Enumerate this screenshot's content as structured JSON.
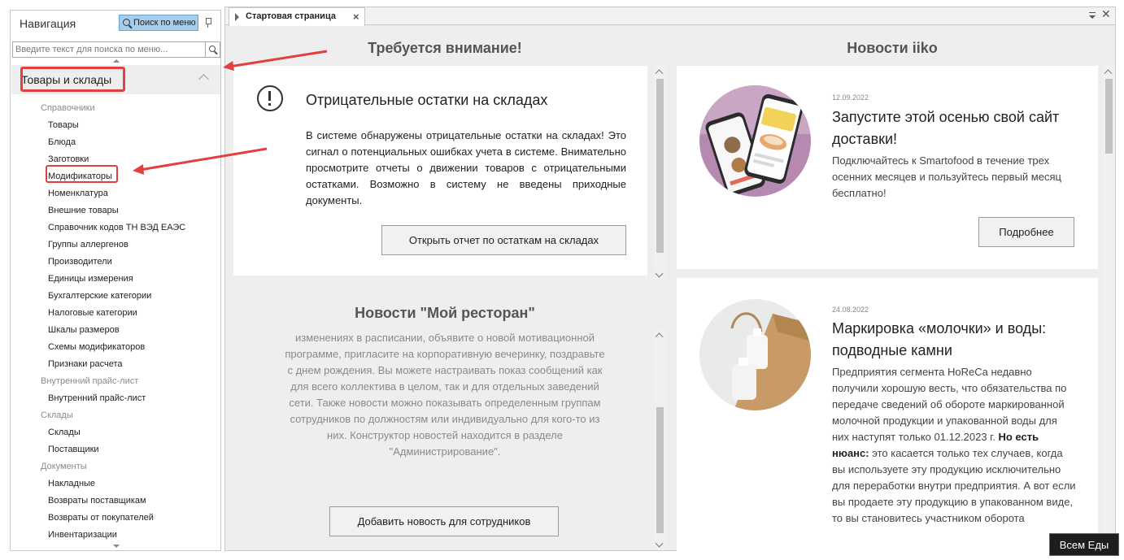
{
  "nav": {
    "title": "Навигация",
    "menu_search_label": "Поиск по меню",
    "search_placeholder": "Введите текст для поиска по меню...",
    "group_title": "Товары и склады",
    "tree": [
      {
        "type": "cat",
        "label": "Справочники"
      },
      {
        "type": "item",
        "label": "Товары"
      },
      {
        "type": "item",
        "label": "Блюда"
      },
      {
        "type": "item",
        "label": "Заготовки"
      },
      {
        "type": "item",
        "label": "Модификаторы"
      },
      {
        "type": "item",
        "label": "Номенклатура"
      },
      {
        "type": "item",
        "label": "Внешние товары"
      },
      {
        "type": "item",
        "label": "Справочник кодов ТН ВЭД ЕАЭС"
      },
      {
        "type": "item",
        "label": "Группы аллергенов"
      },
      {
        "type": "item",
        "label": "Производители"
      },
      {
        "type": "item",
        "label": "Единицы измерения"
      },
      {
        "type": "item",
        "label": "Бухгалтерские категории"
      },
      {
        "type": "item",
        "label": "Налоговые категории"
      },
      {
        "type": "item",
        "label": "Шкалы размеров"
      },
      {
        "type": "item",
        "label": "Схемы модификаторов"
      },
      {
        "type": "item",
        "label": "Признаки расчета"
      },
      {
        "type": "cat",
        "label": "Внутренний прайс-лист"
      },
      {
        "type": "item",
        "label": "Внутренний прайс-лист"
      },
      {
        "type": "cat",
        "label": "Склады"
      },
      {
        "type": "item",
        "label": "Склады"
      },
      {
        "type": "item",
        "label": "Поставщики"
      },
      {
        "type": "cat",
        "label": "Документы"
      },
      {
        "type": "item",
        "label": "Накладные"
      },
      {
        "type": "item",
        "label": "Возвраты поставщикам"
      },
      {
        "type": "item",
        "label": "Возвраты от покупателей"
      },
      {
        "type": "item",
        "label": "Инвентаризации"
      }
    ]
  },
  "tabs": {
    "start_label": "Стартовая страница",
    "close_glyph": "×",
    "window_close_glyph": "✕"
  },
  "attention": {
    "section_title": "Требуется внимание!",
    "heading": "Отрицательные остатки на складах",
    "text": "В системе обнаружены отрицательные остатки на складах! Это сигнал о потенциальных ошибках учета в системе. Внимательно просмотрите отчеты о движении товаров с отрицательными остатками. Возможно в систему не введены приходные документы.",
    "button": "Открыть отчет по остаткам на складах"
  },
  "my_restaurant": {
    "section_title": "Новости \"Мой ресторан\"",
    "text": "изменениях в расписании, объявите о новой мотивационной программе, пригласите на корпоративную вечеринку, поздравьте с днем рождения. Вы можете настраивать показ сообщений как для всего коллектива в целом, так и для отдельных заведений сети. Также новости можно показывать определенным группам сотрудников по должностям или индивидуально для кого-то из них. Конструктор новостей находится в разделе \"Администрирование\".",
    "button": "Добавить новость для сотрудников"
  },
  "iiko_news": {
    "section_title": "Новости iiko",
    "items": [
      {
        "date": "12.09.2022",
        "title": "Запустите этой осенью свой сайт доставки!",
        "text": "Подключайтесь к Smartofood в течение трех осенних месяцев и пользуйтесь первый месяц бесплатно!",
        "button": "Подробнее"
      },
      {
        "date": "24.08.2022",
        "title": "Маркировка «молочки» и воды: подводные камни",
        "text_before": "Предприятия сегмента HoReCa недавно получили хорошую весть, что обязательства по передаче сведений об обороте маркированной молочной продукции и упакованной воды для них наступят только 01.12.2023 г. ",
        "text_bold": "Но есть нюанс:",
        "text_after": " это касается только тех случаев, когда вы используете эту продукцию исключительно для переработки внутри предприятия. А вот если вы продаете эту продукцию в упакованном виде, то вы становитесь участником оборота"
      }
    ]
  },
  "tooltip": "Всем Еды",
  "colors": {
    "highlight_red": "#e0403f",
    "search_button_bg": "#a6cde9"
  }
}
